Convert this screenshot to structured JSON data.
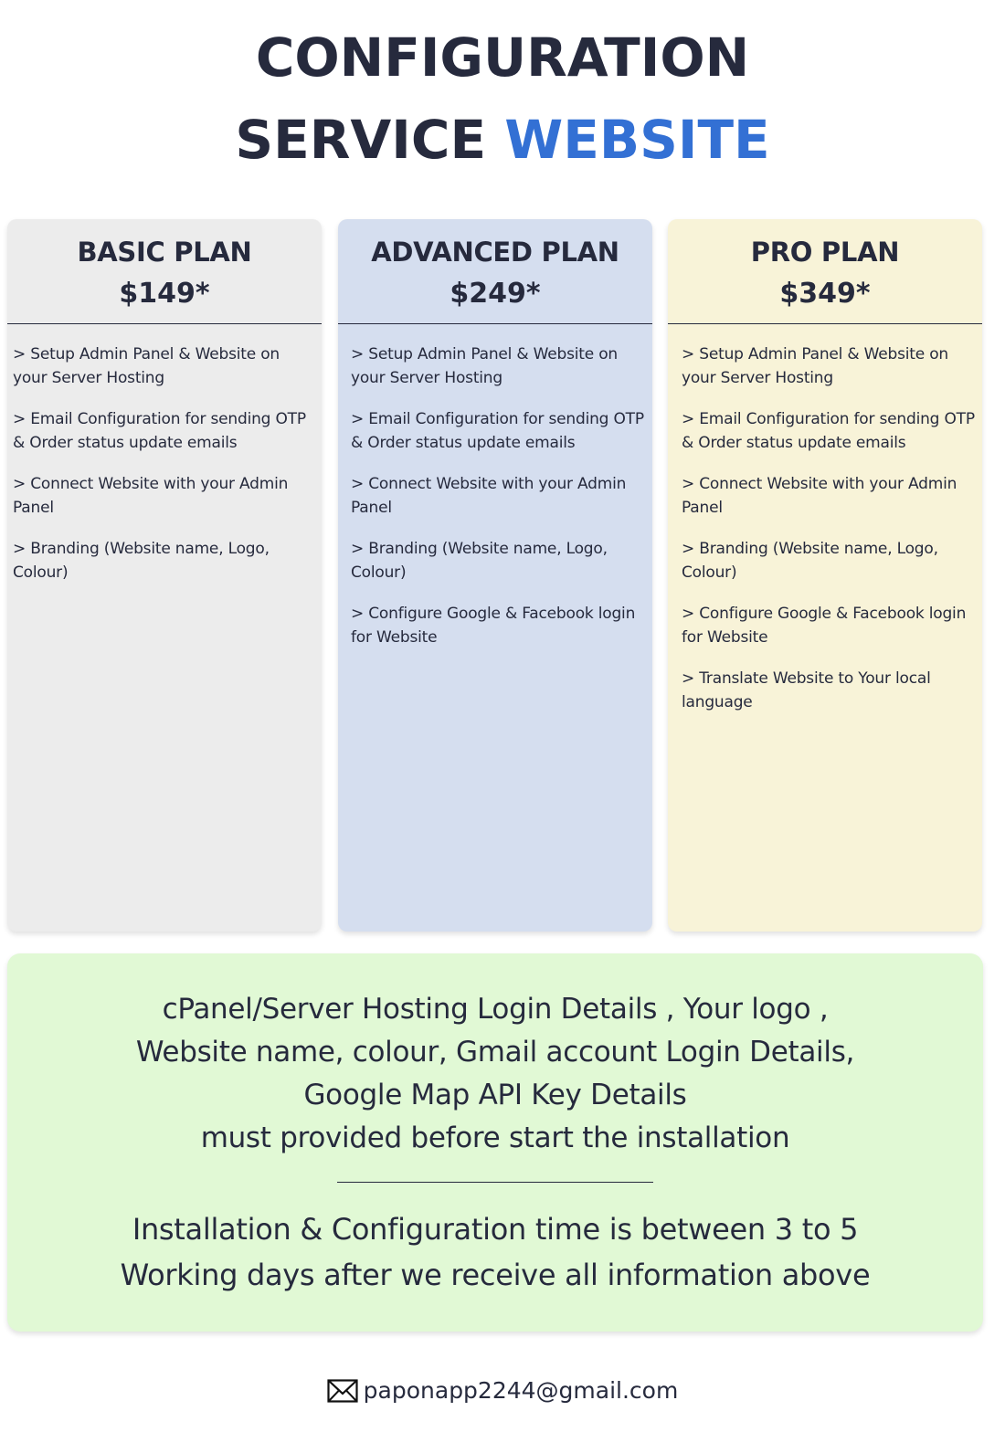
{
  "header": {
    "line1": "CONFIGURATION",
    "line2_prefix": "SERVICE",
    "line2_accent": "WEBSITE",
    "accent_color": "#3370d4"
  },
  "plans": [
    {
      "name": "BASIC PLAN",
      "price": "$149*",
      "background": "#ececec",
      "features": [
        "> Setup Admin Panel  & Website on your Server Hosting",
        "> Email Configuration for sending OTP & Order status update emails",
        "> Connect Website with your Admin Panel",
        "> Branding (Website name, Logo, Colour)"
      ]
    },
    {
      "name": "ADVANCED PLAN",
      "price": "$249*",
      "background": "#d5deef",
      "features": [
        "> Setup Admin Panel  & Website on your Server Hosting",
        "> Email Configuration for sending OTP & Order status update emails",
        "> Connect Website with your Admin Panel",
        "> Branding (Website name, Logo, Colour)",
        "> Configure Google & Facebook login for Website"
      ]
    },
    {
      "name": "PRO PLAN",
      "price": "$349*",
      "background": "#f8f3d8",
      "features": [
        "> Setup Admin Panel  & Website on your Server Hosting",
        "> Email Configuration for sending OTP & Order status update emails",
        "> Connect Website with your Admin Panel",
        "> Branding (Website name, Logo, Colour)",
        "> Configure Google & Facebook login for Website",
        "> Translate Website to Your local language"
      ]
    }
  ],
  "requirements": {
    "lines": [
      "cPanel/Server Hosting Login Details , Your logo ,",
      "Website name, colour, Gmail account Login Details,",
      "Google Map API Key Details",
      "must provided before start the installation"
    ],
    "time_lines": [
      "Installation & Configuration time is between 3 to 5",
      "Working days after we receive all information above"
    ],
    "background": "#e1f9d5"
  },
  "contact": {
    "icon": "mail-icon",
    "email": "paponapp2244@gmail.com"
  }
}
